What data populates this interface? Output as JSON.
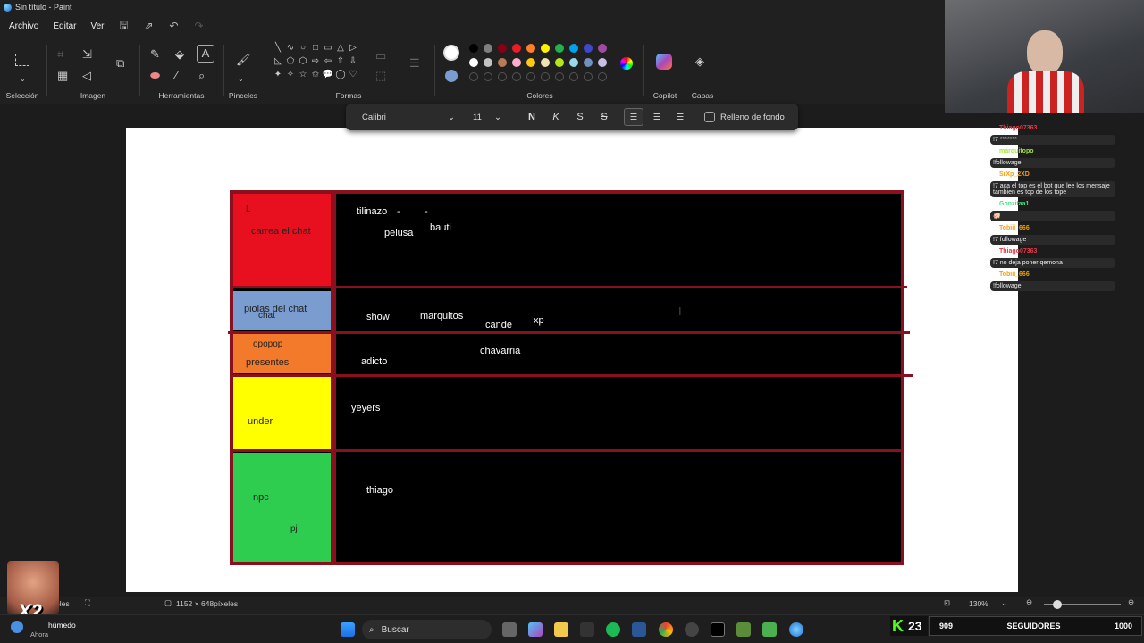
{
  "window": {
    "title": "Sin título - Paint"
  },
  "menu": {
    "file": "Archivo",
    "edit": "Editar",
    "view": "Ver"
  },
  "ribbon": {
    "groups": {
      "selection": "Selección",
      "image": "Imagen",
      "tools": "Herramientas",
      "brushes": "Pinceles",
      "shapes": "Formas",
      "colors": "Colores",
      "copilot": "Copilot",
      "layers": "Capas"
    },
    "shape_glyphs": [
      "╲",
      "∿",
      "○",
      "□",
      "▭",
      "△",
      "▷",
      "◺",
      "⬠",
      "⬡",
      "⇨",
      "⇦",
      "⇧",
      "⇩",
      "✦",
      "✧",
      "☆",
      "✩",
      "💬",
      "◯",
      "♡"
    ],
    "color_row1": [
      "#000000",
      "#7f7f7f",
      "#880015",
      "#ed1c24",
      "#ff7f27",
      "#fff200",
      "#22b14c",
      "#00a2e8",
      "#3f48cc",
      "#a349a4"
    ],
    "color_row2": [
      "#ffffff",
      "#c3c3c3",
      "#b97a57",
      "#ffaec9",
      "#ffc90e",
      "#efe4b0",
      "#b5e61d",
      "#99d9ea",
      "#7092be",
      "#c8bfe7"
    ],
    "color1": "#ffffff",
    "color2": "#7a9ccf"
  },
  "textbar": {
    "font": "Calibri",
    "size": "11",
    "bold": "N",
    "italic": "K",
    "underline": "S",
    "strike": "S",
    "fill_label": "Relleno de fondo"
  },
  "tiers": [
    {
      "label": "carrea el chat",
      "color": "#e8101f",
      "extra": "L",
      "names": [
        "tilinazo",
        "-",
        "-",
        "pelusa",
        "bauti"
      ]
    },
    {
      "label": "piolas del chat",
      "color": "#7a9ccf",
      "extra": "chat",
      "names": [
        "show",
        "marquitos",
        "cande",
        "xp"
      ]
    },
    {
      "label": "presentes",
      "color": "#f27a2a",
      "extra": "opopop",
      "names": [
        "adicto",
        "chavarria"
      ]
    },
    {
      "label": "under",
      "color": "#ffff00",
      "extra": "",
      "names": [
        "yeyers"
      ]
    },
    {
      "label": "npc",
      "color": "#2ecc4f",
      "extra": "pj",
      "names": [
        "thiago"
      ]
    }
  ],
  "status": {
    "dimensions": "1152 × 648píxeles",
    "zoom": "130%",
    "left_text": "eles"
  },
  "taskbar": {
    "weather": "húmedo",
    "weather_sub": "Ahora",
    "search": "Buscar"
  },
  "chat": [
    {
      "user": "Thiago07363",
      "color": "#e63946",
      "text": "!7 *******"
    },
    {
      "user": "marquitopo",
      "color": "#a3e635",
      "text": "!followage"
    },
    {
      "user": "SrXp_2XD",
      "color": "#f59e0b",
      "text": "!7 aca el top es el bot que lee los mensaje tambien es top de los tope"
    },
    {
      "user": "Gonzitaa1",
      "color": "#4ade80",
      "text": "🐖"
    },
    {
      "user": "Tobiii_666",
      "color": "#f59e0b",
      "text": "!7 followage"
    },
    {
      "user": "Thiago07363",
      "color": "#e63946",
      "text": "!7 no deja poner qemona"
    },
    {
      "user": "Tobiii_666",
      "color": "#f59e0b",
      "text": "!followage"
    }
  ],
  "overlay": {
    "kick_count": "23",
    "followers_current": "909",
    "followers_label": "SEGUIDORES",
    "followers_goal": "1000",
    "multiplier": "X2"
  }
}
